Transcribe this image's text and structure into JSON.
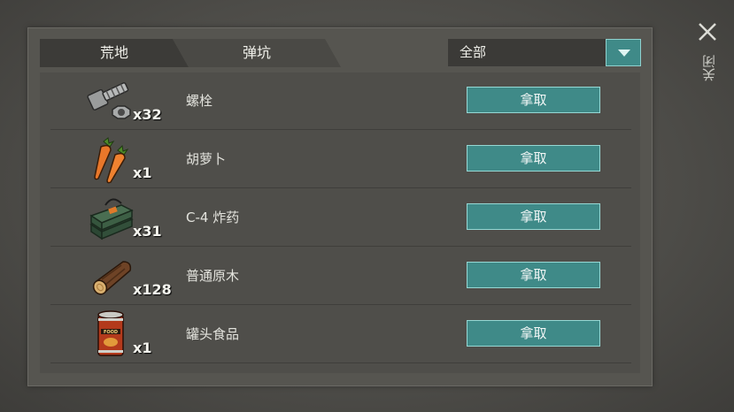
{
  "tabs": [
    {
      "label": "荒地"
    },
    {
      "label": "弹坑"
    }
  ],
  "filter": {
    "selected": "全部"
  },
  "items": [
    {
      "name": "螺栓",
      "qty": "x32",
      "icon": "bolt-icon",
      "action": "拿取"
    },
    {
      "name": "胡萝卜",
      "qty": "x1",
      "icon": "carrot-icon",
      "action": "拿取"
    },
    {
      "name": "C-4 炸药",
      "qty": "x31",
      "icon": "c4-explosive-icon",
      "action": "拿取"
    },
    {
      "name": "普通原木",
      "qty": "x128",
      "icon": "log-icon",
      "action": "拿取"
    },
    {
      "name": "罐头食品",
      "qty": "x1",
      "icon": "canned-food-icon",
      "action": "拿取"
    }
  ],
  "can_label": "FOOD",
  "close": {
    "label": "关闭"
  },
  "colors": {
    "accent": "#3f8a88",
    "accent_border": "#96d8d4"
  }
}
